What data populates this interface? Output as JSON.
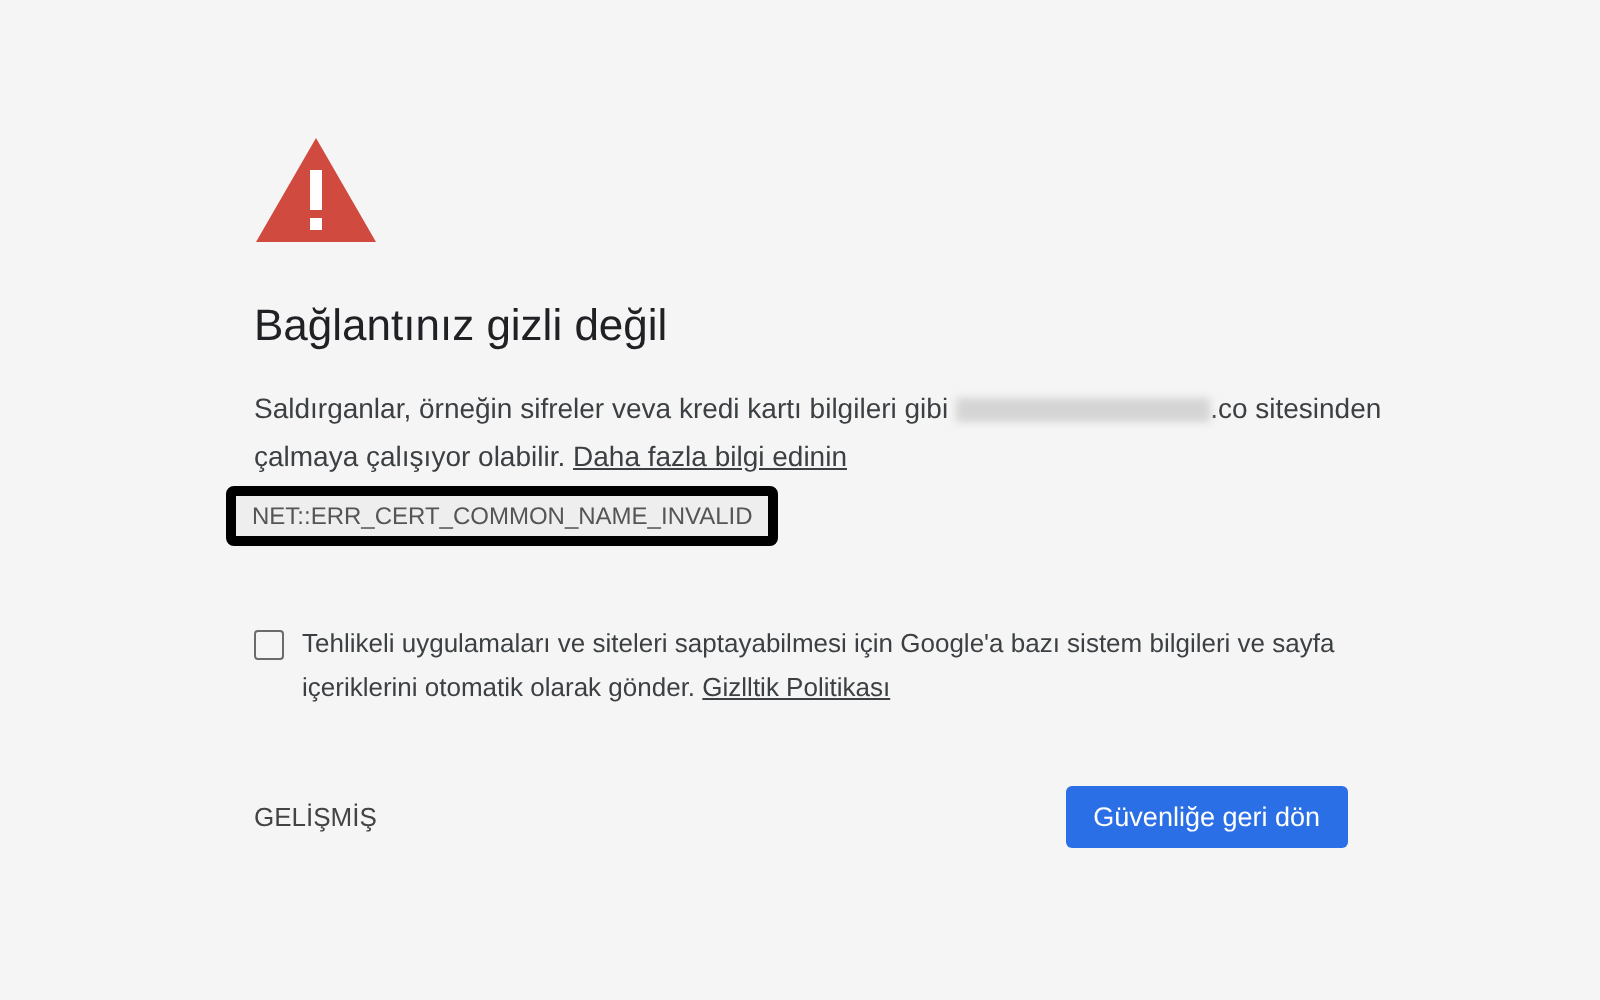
{
  "heading": "Bağlantınız gizli değil",
  "message": {
    "before": "Saldırganlar, örneğin sifreler veva kredi kartı bilgileri gibi",
    "after": ".co sitesinden çalmaya çalışıyor olabilir.",
    "link": "Daha fazla bilgi edinin"
  },
  "error_code": {
    "text": "NET::ERR_CERT_COMMON_NAME_INVALID",
    "highlighted": true
  },
  "report": {
    "checked": false,
    "text": "Tehlikeli uygulamaları ve siteleri saptayabilmesi için Google'a bazı sistem bilgileri ve sayfa içeriklerini otomatik olarak gönder.",
    "link": "Gizlltik Politikası"
  },
  "buttons": {
    "advanced": "GELİŞMİŞ",
    "back": "Güvenliğe geri dön"
  }
}
